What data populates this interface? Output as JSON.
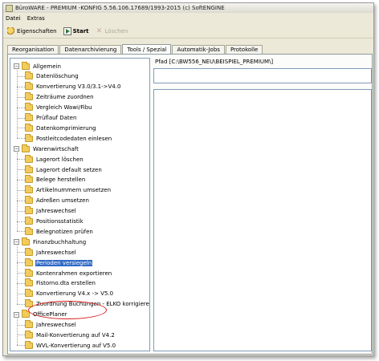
{
  "window": {
    "title": "BüroWARE - PREMIUM -KONFIG 5.56.106.17689/1993-2015 (c) SoftENGINE"
  },
  "menu": [
    "Datei",
    "Extras"
  ],
  "toolbar": {
    "properties_label": "Eigenschaften",
    "start_label": "Start",
    "delete_label": "Löschen"
  },
  "tabs": [
    "Reorganisation",
    "Datenarchivierung",
    "Tools / Spezial",
    "Automatik-Jobs",
    "Protokolle"
  ],
  "active_tab": "Tools / Spezial",
  "path_label": "Pfad [C:\\BW556_NEU\\BEISPIEL_PREMIUM\\]",
  "tree": [
    {
      "label": "Allgemein",
      "expanded": true,
      "children": [
        "Datenlöschung",
        "Konvertierung V3.0/3.1->V4.0",
        "Zeiträume zuordnen",
        "Vergleich Wawi/Fibu",
        "Prüflauf Daten",
        "Datenkomprimierung",
        "Postleitcodedaten einlesen"
      ]
    },
    {
      "label": "Warenwirtschaft",
      "expanded": true,
      "children": [
        "Lagerort löschen",
        "Lagerort default setzen",
        "Belege herstellen",
        "Artikelnummern umsetzen",
        "Adreßen umsetzen",
        "Jahreswechsel",
        "Positionsstatistik",
        "Belegnotizen prüfen"
      ]
    },
    {
      "label": "Finanzbuchhaltung",
      "expanded": true,
      "children": [
        "Jahreswechsel",
        "Perioden versiegeln",
        "Kontenrahmen exportieren",
        "Fistorno.dta erstellen",
        "Konvertierung V4.x -> V5.0",
        "Zuordnung Buchungen - ELKO korrigieren"
      ]
    },
    {
      "label": "OfficePlaner",
      "expanded": true,
      "children": [
        "Jahreswechsel",
        "Mail-Konvertierung auf V4.2",
        "WVL-Konvertierung auf V5.0"
      ]
    }
  ],
  "selected_item": "Perioden versiegeln",
  "colors": {
    "selection": "#316ac5",
    "highlight_ring": "#d81c1c",
    "window_bg": "#ece9d8"
  }
}
